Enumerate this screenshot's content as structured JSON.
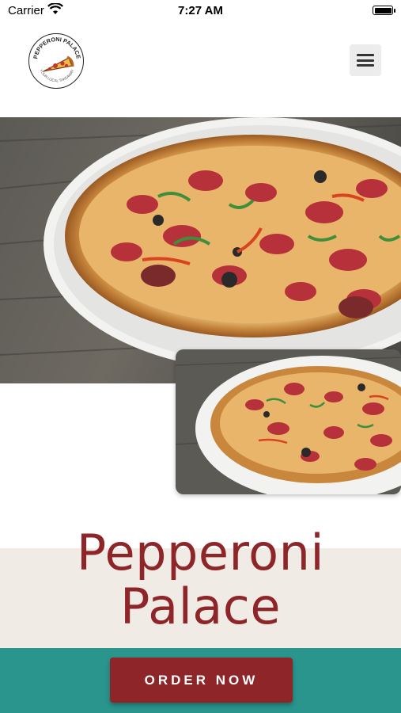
{
  "status_bar": {
    "carrier": "Carrier",
    "time": "7:27 AM",
    "icons": [
      "wifi-icon",
      "battery-icon"
    ]
  },
  "header": {
    "logo": {
      "name": "PEPPERONI PALACE",
      "tagline": "YOUR LOCAL TAKEAWAY",
      "icon": "pizza-slice-icon"
    },
    "menu_icon": "hamburger-menu-icon"
  },
  "images": {
    "hero": "pizza-photo",
    "inset": "pizza-photo-thumbnail"
  },
  "main": {
    "title_line1": "Pepperoni",
    "title_line2": "Palace"
  },
  "footer": {
    "order_button_label": "ORDER NOW"
  },
  "colors": {
    "brand_red": "#8e2529",
    "teal": "#2a958c",
    "cream": "#f1ebe5"
  }
}
